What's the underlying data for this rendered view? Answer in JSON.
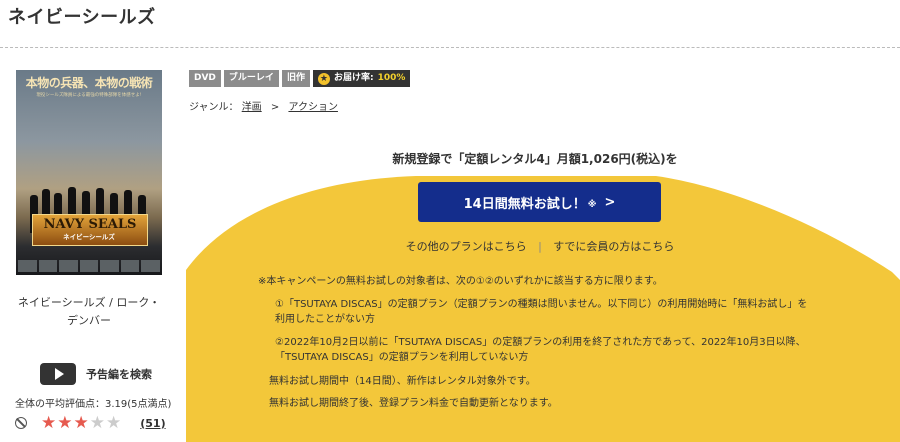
{
  "page_title": "ネイビーシールズ",
  "cover": {
    "headline": "本物の兵器、本物の戦術",
    "subline": "現役シールズ隊員による最強の特殊部隊を体感せよ!",
    "banner": "NAVY SEALS",
    "banner_sub": "ネイビーシールズ",
    "caption": "ネイビーシールズ / ローク・デンバー"
  },
  "trailer": {
    "label": "予告編を検索"
  },
  "rating": {
    "average_text": "全体の平均評価点：3.19(5点満点)",
    "stars_filled": 3,
    "stars_total": 5,
    "count_text": "(51)"
  },
  "badges": [
    "DVD",
    "ブルーレイ",
    "旧作"
  ],
  "delivery_badge": {
    "label": "お届け率:",
    "value": "100%"
  },
  "genre": {
    "label": "ジャンル：",
    "items": [
      "洋画",
      "アクション"
    ],
    "separator": ">"
  },
  "cta": {
    "heading": "新規登録で「定額レンタル4」月額1,026円(税込)を",
    "button_label": "14日間無料お試し！",
    "button_note": "※",
    "link_other_plans": "その他のプランはこちら",
    "link_divider": "|",
    "link_members": "すでに会員の方はこちら"
  },
  "notes": {
    "intro": "※本キャンペーンの無料お試しの対象者は、次の①②のいずれかに該当する方に限ります。",
    "item1_line1": "①「TSUTAYA DISCAS」の定額プラン（定額プランの種類は問いません。以下同じ）の利用開始時に「無料お試し」を",
    "item1_line2": "利用したことがない方",
    "item2_line1": "②2022年10月2日以前に「TSUTAYA DISCAS」の定額プランの利用を終了された方であって、2022年10月3日以降、",
    "item2_line2": "「TSUTAYA DISCAS」の定額プランを利用していない方",
    "period": "無料お試し期間中（14日間）、新作はレンタル対象外です。",
    "renewal": "無料お試し期間終了後、登録プラン料金で自動更新となります。"
  },
  "colors": {
    "accent_yellow": "#f3c73a",
    "button_navy": "#142d8c",
    "star_red": "#e65a4f"
  }
}
